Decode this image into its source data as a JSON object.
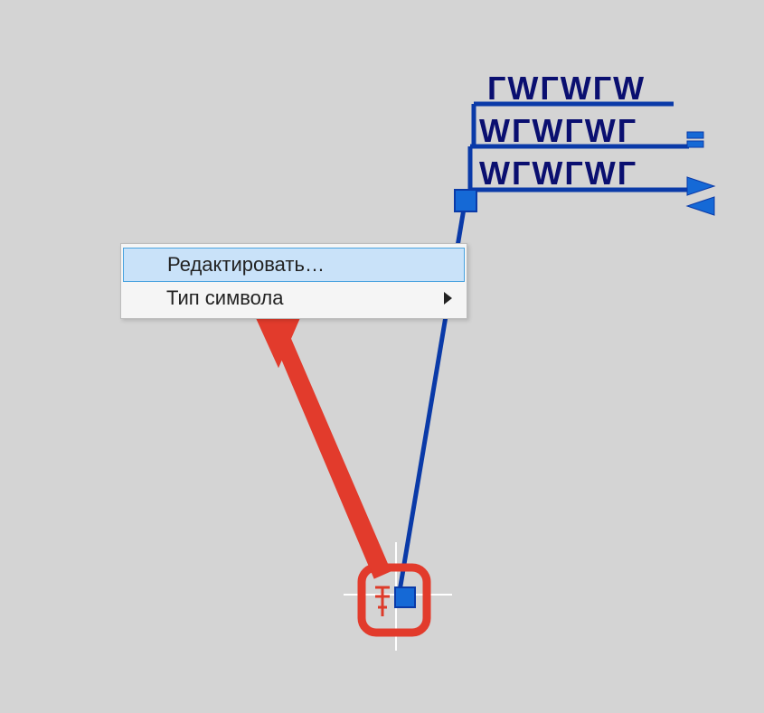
{
  "context_menu": {
    "edit_label": "Редактировать…",
    "type_label": "Тип символа"
  },
  "sign_rows": {
    "row1": "ГWГWГW",
    "row2": "WГWГWГ",
    "row3": "WГWГWГ"
  },
  "colors": {
    "schematic_stroke": "#0a3aa8",
    "schematic_fill": "#1569d6",
    "sign_text": "#0a0f70",
    "marker_red": "#dd3b2a",
    "annotation_red": "#e23b2c",
    "menu_highlight_bg": "#c9e2f9",
    "menu_highlight_border": "#4aa3df",
    "canvas_bg": "#d4d4d4"
  }
}
